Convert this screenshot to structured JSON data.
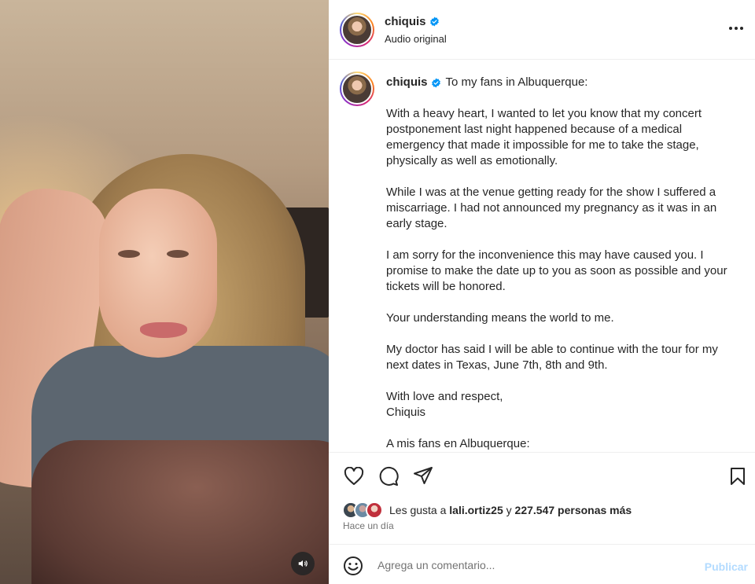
{
  "post": {
    "username": "chiquis",
    "audio_label": "Audio original",
    "verified_icon": "verified-badge-icon",
    "more_icon": "more-options-icon"
  },
  "caption": {
    "username": "chiquis",
    "intro": "To my fans in Albuquerque:",
    "paragraphs": [
      "With a heavy heart, I wanted to let you know that my concert postponement last night happened because of a medical emergency that made it impossible for me to take the stage, physically as well as emotionally.",
      "While I was at the venue getting ready for the show I suffered a miscarriage. I had not announced my pregnancy as it was in an early stage.",
      "I am sorry for the inconvenience this may have caused you. I promise to make the date up to you as soon as possible and your tickets will be honored.",
      "Your understanding means the world to me.",
      "My doctor has said I will be able to continue with the tour for my next dates in Texas, June 7th, 8th and 9th.",
      "With love and respect,\nChiquis",
      "A mis fans en Albuquerque:"
    ]
  },
  "actions": {
    "like_icon": "heart-icon",
    "comment_icon": "comment-icon",
    "share_icon": "share-icon",
    "save_icon": "bookmark-icon"
  },
  "likes": {
    "prefix": "Les gusta a",
    "user": "lali.ortiz25",
    "conjunction": "y",
    "others": "227.547 personas más"
  },
  "timestamp": "Hace un día",
  "comment": {
    "placeholder": "Agrega un comentario...",
    "publish_label": "Publicar",
    "emoji_icon": "emoji-icon"
  },
  "media": {
    "sound_icon": "speaker-icon"
  },
  "colors": {
    "text": "#262626",
    "secondary": "#737373",
    "verified": "#0095f6",
    "publish_disabled": "#b3dbff",
    "divider": "#efefef"
  }
}
